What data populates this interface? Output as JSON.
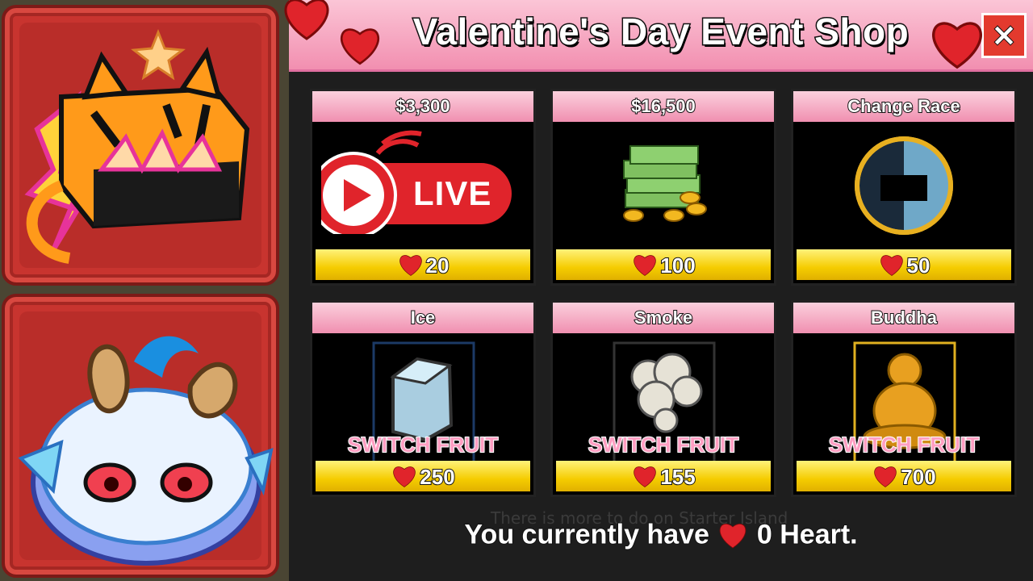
{
  "shop": {
    "title": "Valentine's Day Event Shop",
    "close_label": "×",
    "background_hint": "There is more to do on Starter Island",
    "footer": {
      "prefix": "You currently have",
      "amount": "0 Heart."
    }
  },
  "badge": {
    "live_label": "LIVE"
  },
  "items": [
    {
      "name": "$3,300",
      "price": "20",
      "kind": "money-small"
    },
    {
      "name": "$16,500",
      "price": "100",
      "kind": "money-stack"
    },
    {
      "name": "Change Race",
      "price": "50",
      "kind": "race-orb"
    },
    {
      "name": "Ice",
      "price": "250",
      "tag": "SWITCH FRUIT",
      "kind": "ice"
    },
    {
      "name": "Smoke",
      "price": "155",
      "tag": "SWITCH FRUIT",
      "kind": "smoke"
    },
    {
      "name": "Buddha",
      "price": "700",
      "tag": "SWITCH FRUIT",
      "kind": "buddha"
    }
  ],
  "colors": {
    "header_pink": "#f28fb0",
    "price_yellow": "#f5cc00",
    "heart_red": "#e0242b",
    "tile_red": "#c8342f"
  },
  "icons": [
    "heart-icon",
    "close-icon",
    "live-play-icon",
    "tiger-fruit-icon",
    "kitsune-fruit-icon"
  ]
}
